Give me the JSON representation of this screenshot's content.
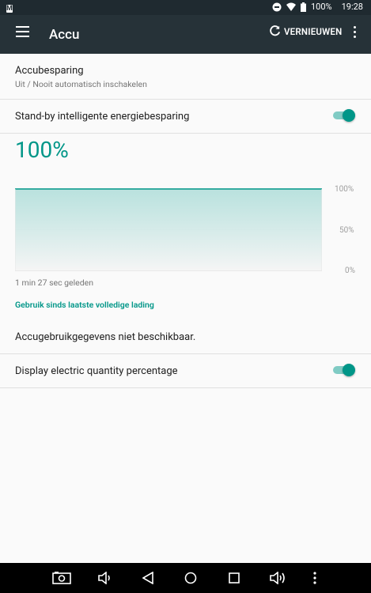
{
  "status_bar": {
    "time": "19:28",
    "battery": "100%",
    "icons": [
      "mail-icon",
      "do-not-disturb-icon",
      "wifi-icon",
      "battery-icon"
    ]
  },
  "toolbar": {
    "title": "Accu",
    "refresh_label": "VERNIEUWEN"
  },
  "battery_saver": {
    "title": "Accubesparing",
    "subtitle": "Uit / Nooit automatisch inschakelen"
  },
  "standby": {
    "label": "Stand-by intelligente energiebesparing",
    "enabled": true
  },
  "battery_level": "100%",
  "chart_data": {
    "type": "area",
    "y_ticks": [
      "100%",
      "50%",
      "0%"
    ],
    "ylim": [
      0,
      100
    ],
    "x": [
      0,
      1
    ],
    "values": [
      100,
      100
    ],
    "color": "#009688"
  },
  "last_update": "1 min 27 sec geleden",
  "usage_link": "Gebruik sinds laatste volledige lading",
  "no_data": "Accugebruikgegevens niet beschikbaar.",
  "display_percentage": {
    "label": "Display electric quantity percentage",
    "enabled": true
  },
  "accent_color": "#009688",
  "toolbar_color": "#263238"
}
